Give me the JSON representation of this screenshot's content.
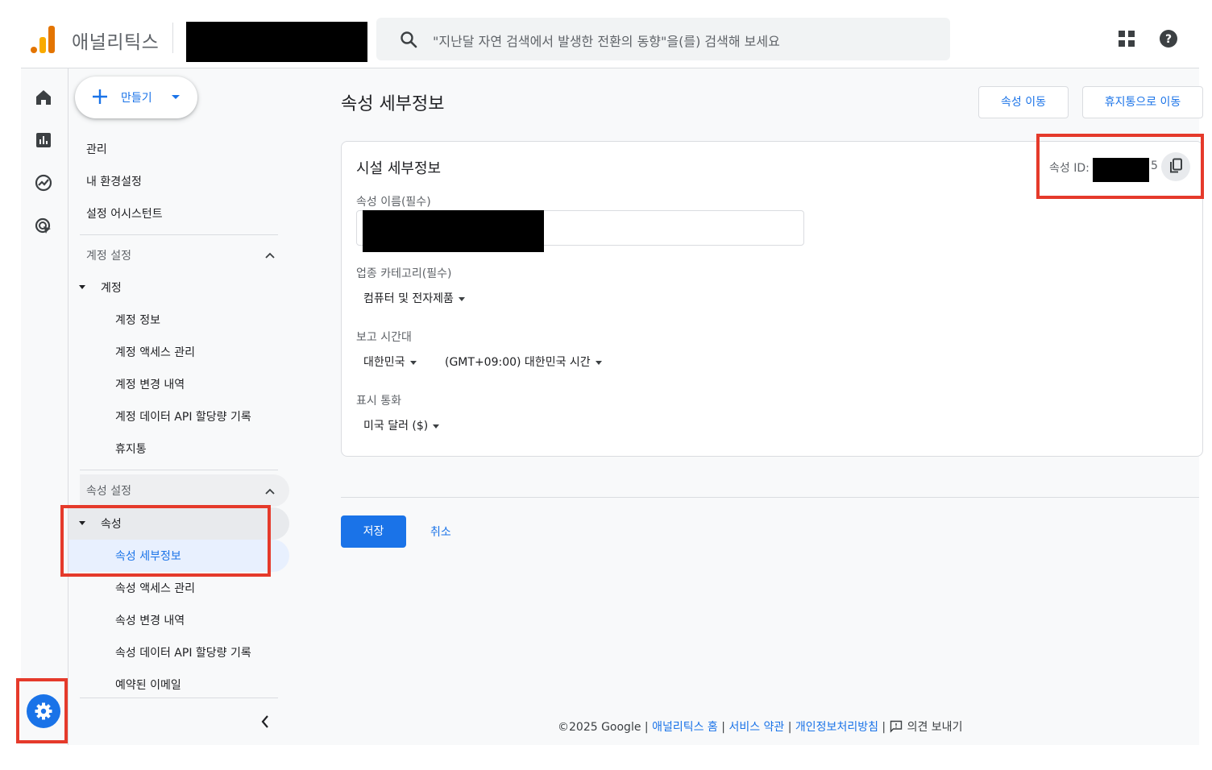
{
  "app": {
    "name": "애널리틱스"
  },
  "search": {
    "placeholder": "\"지난달 자연 검색에서 발생한 전환의 동향\"을(를) 검색해 보세요"
  },
  "nav": {
    "create_label": "만들기",
    "top_items": [
      "관리",
      "내 환경설정",
      "설정 어시스턴트"
    ],
    "account_section": {
      "title": "계정 설정",
      "group_label": "계정",
      "items": [
        "계정 정보",
        "계정 액세스 관리",
        "계정 변경 내역",
        "계정 데이터 API 할당량 기록",
        "휴지통"
      ]
    },
    "property_section": {
      "title": "속성 설정",
      "group_label": "속성",
      "items": [
        "속성 세부정보",
        "속성 액세스 관리",
        "속성 변경 내역",
        "속성 데이터 API 할당량 기록",
        "예약된 이메일"
      ]
    }
  },
  "main": {
    "title": "속성 세부정보",
    "move_property_label": "속성 이동",
    "move_trash_label": "휴지통으로 이동",
    "card": {
      "title": "시설 세부정보",
      "property_id_label": "속성 ID:",
      "property_id_suffix": "5",
      "name_label": "속성 이름(필수)",
      "category_label": "업종 카테고리(필수)",
      "category_value": "컴퓨터 및 전자제품",
      "timezone_label": "보고 시간대",
      "country_value": "대한민국",
      "timezone_value": "(GMT+09:00) 대한민국 시간",
      "currency_label": "표시 통화",
      "currency_value": "미국 달러 ($)"
    },
    "save_label": "저장",
    "cancel_label": "취소"
  },
  "footer": {
    "copyright": "©2025 Google",
    "sep": " | ",
    "links": [
      "애널리틱스 홈",
      "서비스 약관",
      "개인정보처리방침"
    ],
    "feedback": "의견 보내기"
  },
  "colors": {
    "accent": "#1a73e8",
    "highlight": "#e53a2b",
    "logo_orange": "#f9ab00",
    "logo_dark": "#e37400"
  }
}
